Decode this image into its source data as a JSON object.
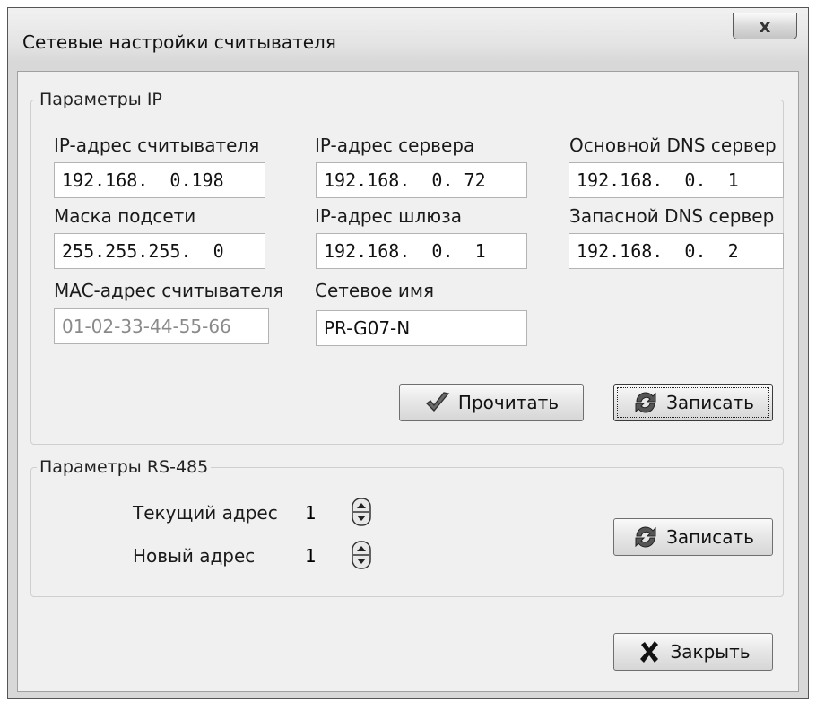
{
  "window": {
    "title": "Сетевые настройки считывателя",
    "close_glyph": "x"
  },
  "ip_group": {
    "legend": "Параметры IP",
    "reader_ip": {
      "label": "IP-адрес считывателя",
      "value": "192.168.  0.198"
    },
    "server_ip": {
      "label": "IP-адрес сервера",
      "value": "192.168.  0. 72"
    },
    "primary_dns": {
      "label": "Основной DNS сервер",
      "value": "192.168.  0.  1"
    },
    "subnet_mask": {
      "label": "Маска подсети",
      "value": "255.255.255.  0"
    },
    "gateway_ip": {
      "label": "IP-адрес шлюза",
      "value": "192.168.  0.  1"
    },
    "secondary_dns": {
      "label": "Запасной DNS сервер",
      "value": "192.168.  0.  2"
    },
    "mac": {
      "label": "MAC-адрес считывателя",
      "value": "01-02-33-44-55-66"
    },
    "network_name": {
      "label": "Сетевое имя",
      "value": "PR-G07-N"
    },
    "read_button": "Прочитать",
    "write_button": "Записать"
  },
  "rs485_group": {
    "legend": "Параметры RS-485",
    "current_address": {
      "label": "Текущий адрес",
      "value": "1"
    },
    "new_address": {
      "label": "Новый адрес",
      "value": "1"
    },
    "write_button": "Записать"
  },
  "footer": {
    "close_button": "Закрыть"
  }
}
